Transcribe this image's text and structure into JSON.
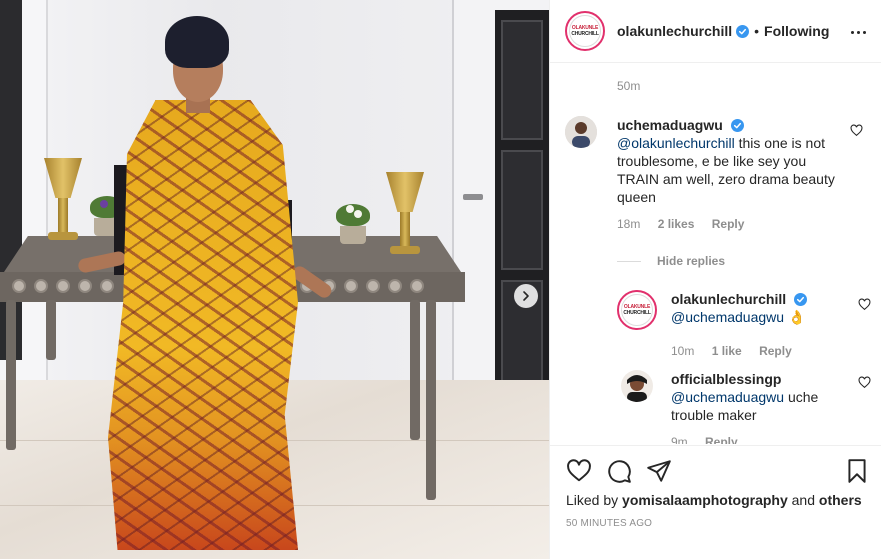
{
  "post": {
    "author": "olakunlechurchill",
    "follow_status": "Following",
    "separator": "•",
    "avatar_text_top": "OLAKUNLE",
    "avatar_text_bottom": "CHURCHILL",
    "caption_time": "50m",
    "likes_prefix": "Liked by",
    "liked_by": "yomisalaamphotography",
    "likes_and": "and",
    "likes_others": "others",
    "time_ago": "50 MINUTES AGO"
  },
  "comments": [
    {
      "username": "uchemaduagwu",
      "verified": true,
      "mention": "@olakunlechurchill",
      "text": "this one is not troublesome, e be like sey you TRAIN am well, zero drama beauty queen",
      "time": "18m",
      "likes": "2 likes",
      "reply_label": "Reply"
    }
  ],
  "hide_replies_label": "Hide replies",
  "replies": [
    {
      "username": "olakunlechurchill",
      "verified": true,
      "mention": "@uchemaduagwu",
      "text": "👌",
      "time": "10m",
      "likes": "1 like",
      "reply_label": "Reply"
    },
    {
      "username": "officialblessingp",
      "verified": false,
      "mention": "@uchemaduagwu",
      "text": "uche trouble maker",
      "time": "9m",
      "reply_label": "Reply"
    }
  ],
  "icons": {
    "verified": "verified-badge-icon",
    "like": "heart-icon",
    "comment": "comment-icon",
    "share": "paper-plane-icon",
    "save": "bookmark-icon",
    "more": "more-options-icon",
    "next": "chevron-right-icon"
  },
  "colors": {
    "verified_blue": "#3897f0",
    "story_ring": "#e1306c",
    "mention": "#00376b",
    "muted": "#8e8e8e"
  }
}
